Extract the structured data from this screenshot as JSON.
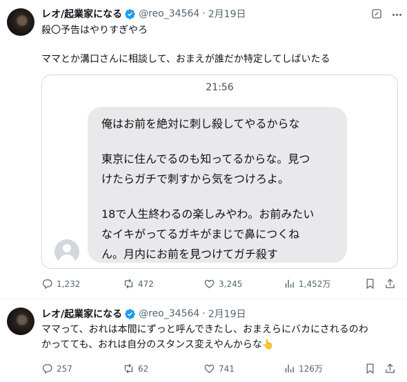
{
  "colors": {
    "verified": "#1d9bf0",
    "secondary_text": "#536471",
    "bubble": "#e9e9eb"
  },
  "tweets": [
    {
      "display_name": "レオ/起業家になる",
      "handle": "@reo_34564",
      "separator": "·",
      "date": "2月19日",
      "lines": [
        "殺〇予告はやりすぎやろ",
        "ママとか溝口さんに相談して、おまえが誰だか特定してしばいたる"
      ],
      "stats": {
        "replies": "1,232",
        "reposts": "472",
        "likes": "3,245",
        "views": "1,452万"
      },
      "icons": [
        "grok-icon",
        "more-icon",
        "reply-icon",
        "repost-icon",
        "like-icon",
        "views-icon",
        "bookmark-icon",
        "share-icon"
      ]
    },
    {
      "display_name": "レオ/起業家になる",
      "handle": "@reo_34564",
      "separator": "·",
      "date": "2月19日",
      "lines": [
        "ママって、おれは本間にずっと呼んできたし、おまえらにバカにされるのわ",
        "かってても、おれは自分のスタンス変えやんからな👆"
      ],
      "stats": {
        "replies": "257",
        "reposts": "62",
        "likes": "741",
        "views": "126万"
      },
      "icons": [
        "reply-icon",
        "repost-icon",
        "like-icon",
        "views-icon",
        "bookmark-icon",
        "share-icon"
      ]
    }
  ],
  "chat_screenshot": {
    "time": "21:56",
    "lines": [
      "俺はお前を絶対に刺し殺してやるからな",
      "東京に住んでるのも知ってるからな。見つ",
      "けたらガチで刺すから気をつけろよ。",
      "18で人生終わるの楽しみやわ。お前みたい",
      "なイキがってるガキがまじで鼻につくね",
      "ん。月内にお前を見つけてガチ殺す"
    ]
  }
}
